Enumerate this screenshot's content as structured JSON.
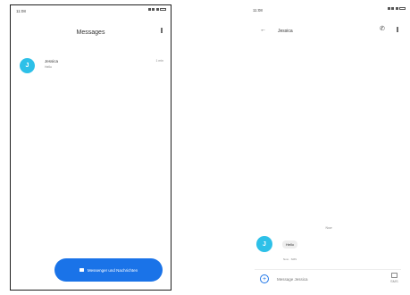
{
  "left": {
    "status_time": "11:08",
    "title": "Messages",
    "conversation": {
      "avatar_initial": "J",
      "name": "Jessica",
      "snippet": "Hello",
      "time": "1 min"
    },
    "fab_label": "Messenger und Nachrichten"
  },
  "right": {
    "status_time": "11:08",
    "contact_name": "Jessica",
    "day_separator": "Now",
    "message": {
      "avatar_initial": "J",
      "text": "Hello",
      "meta": "Now · SMS"
    },
    "composer_placeholder": "Message Jessica",
    "sms_label": "SMS"
  },
  "colors": {
    "accent": "#1a73e8",
    "avatar": "#2dc0e8"
  },
  "icons": [
    "back-arrow-icon",
    "phone-icon",
    "more-vert-icon",
    "add-icon",
    "send-sms-icon",
    "chat-icon"
  ]
}
